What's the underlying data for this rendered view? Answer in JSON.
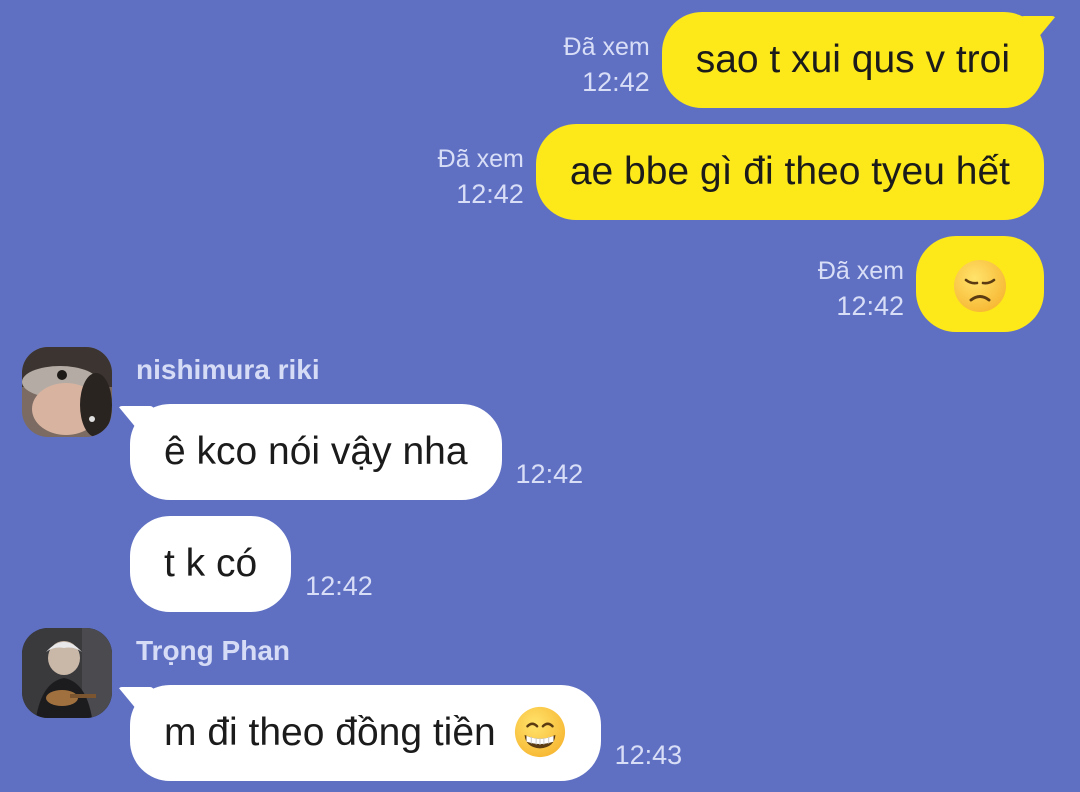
{
  "messages_out": [
    {
      "text": "sao t xui qus v troi",
      "seen": "Đã xem",
      "time": "12:42"
    },
    {
      "text": "ae bbe gì đi theo tyeu hết",
      "seen": "Đã xem",
      "time": "12:42"
    },
    {
      "emoji": "disappointed-face",
      "seen": "Đã xem",
      "time": "12:42"
    }
  ],
  "groups_in": [
    {
      "sender": "nishimura riki",
      "avatar_icon": "avatar-photo",
      "messages": [
        {
          "text": "ê kco nói vậy nha",
          "time": "12:42"
        },
        {
          "text": "t k có",
          "time": "12:42"
        }
      ]
    },
    {
      "sender": "Trọng Phan",
      "avatar_icon": "avatar-photo",
      "messages": [
        {
          "text": "m đi theo đồng tiền",
          "emoji": "grinning-face",
          "time": "12:43"
        }
      ]
    }
  ],
  "colors": {
    "background": "#5f70c3",
    "outgoing_bubble": "#fde81a",
    "incoming_bubble": "#ffffff",
    "meta_text": "#d9def7"
  }
}
